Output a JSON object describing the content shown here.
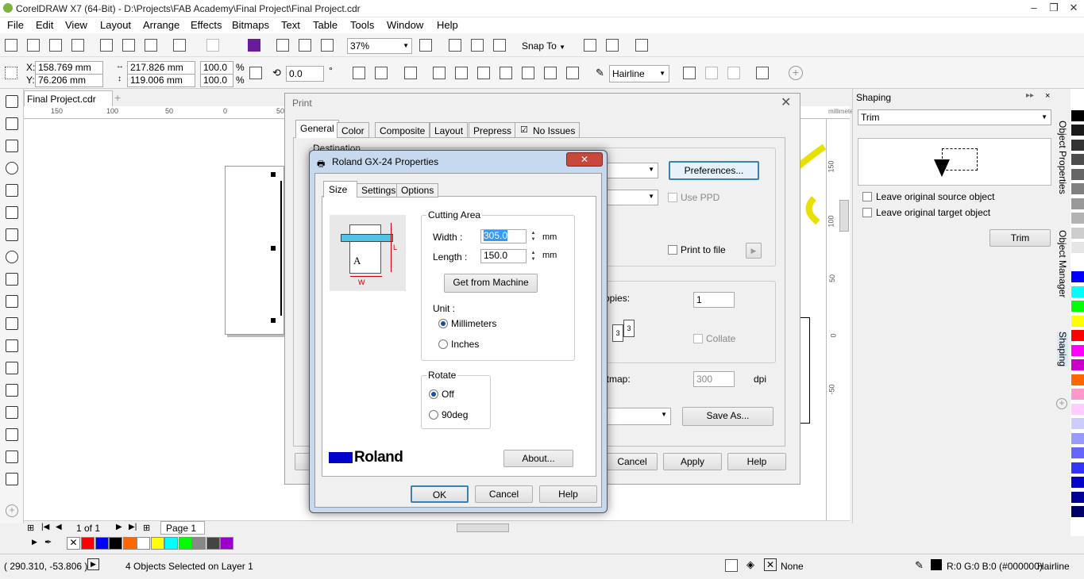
{
  "window": {
    "title": "CorelDRAW X7 (64-Bit) - D:\\Projects\\FAB Academy\\Final Project\\Final Project.cdr",
    "min": "–",
    "max": "❐",
    "close": "✕"
  },
  "menu": [
    "File",
    "Edit",
    "View",
    "Layout",
    "Arrange",
    "Effects",
    "Bitmaps",
    "Text",
    "Table",
    "Tools",
    "Window",
    "Help"
  ],
  "toolbar": {
    "zoom": "37%",
    "snap": "Snap To",
    "snap_arrow": "▼",
    "zoom_arrow": "▼"
  },
  "propbar": {
    "x_label": "X:",
    "x": "158.769 mm",
    "y_label": "Y:",
    "y": "76.206 mm",
    "w": "217.826 mm",
    "h": "119.006 mm",
    "sx": "100.0",
    "sy": "100.0",
    "pct1": "%",
    "pct2": "%",
    "rot": "0.0",
    "deg": "°",
    "outline": "Hairline",
    "outline_arrow": "▼"
  },
  "doc_tab": {
    "label": "Final Project.cdr",
    "plus": "+"
  },
  "ruler": {
    "ticks": [
      "150",
      "100",
      "50",
      "0",
      "50"
    ],
    "unit_v": "millimeters",
    "vticks": [
      "150",
      "100",
      "50",
      "0",
      "-50"
    ]
  },
  "shaping": {
    "title": "Shaping",
    "mode": "Trim",
    "arrow": "▼",
    "opt1": "Leave original source object",
    "opt2": "Leave original target object",
    "apply": "Trim",
    "collapse": "▸▸",
    "close": "×"
  },
  "sidetabs": [
    "Object Properties",
    "Object Manager",
    "Shaping"
  ],
  "page_nav": {
    "count": "1 of 1",
    "page": "Page 1"
  },
  "status": {
    "coords": "( 290.310, -53.806 )",
    "arrow": "▶",
    "selection": "4 Objects Selected on Layer 1",
    "fill": "None",
    "color": "R:0 G:0 B:0 (#000000)",
    "outline": "Hairline"
  },
  "print": {
    "title": "Print",
    "close": "✕",
    "tabs": [
      "General",
      "Color",
      "Composite",
      "Layout",
      "Prepress",
      "No Issues"
    ],
    "destination": "Destination",
    "preferences": "Preferences...",
    "use_ppd": "Use PPD",
    "print_to_file": "Print to file",
    "copies_label": "opies:",
    "copies": "1",
    "collate": "Collate",
    "bitmap_label": "itmap:",
    "bitmap_dpi": "300",
    "dpi": "dpi",
    "save_as": "Save As...",
    "cancel": "Cancel",
    "apply": "Apply",
    "help": "Help"
  },
  "roland": {
    "title": "Roland GX-24 Properties",
    "close": "✕",
    "tabs": [
      "Size",
      "Settings",
      "Options"
    ],
    "cutting_area": "Cutting Area",
    "width_label": "Width :",
    "width": "305.0",
    "length_label": "Length :",
    "length": "150.0",
    "mm1": "mm",
    "mm2": "mm",
    "get_from_machine": "Get from Machine",
    "unit": "Unit :",
    "millimeters": "Millimeters",
    "inches": "Inches",
    "rotate": "Rotate",
    "off": "Off",
    "deg90": "90deg",
    "brand": "Roland",
    "about": "About...",
    "ok": "OK",
    "cancel": "Cancel",
    "help": "Help",
    "diagram_a": "A",
    "diagram_l": "L",
    "diagram_w": "W"
  },
  "palette": {
    "colors": [
      "#ff0000",
      "#0000ff",
      "#000000",
      "#ff6600",
      "#ffffff",
      "#ffff00",
      "#00ffff",
      "#00ff00",
      "#888888",
      "#444444",
      "#9900cc"
    ]
  },
  "vpalette": {
    "colors": [
      "#ffffff",
      "#000000",
      "#1a1a1a",
      "#333333",
      "#4d4d4d",
      "#666666",
      "#808080",
      "#999999",
      "#b3b3b3",
      "#cccccc",
      "#e6e6e6",
      "#ffffff",
      "#0000ff",
      "#00ffff",
      "#00ff00",
      "#ffff00",
      "#ff0000",
      "#ff00ff",
      "#cc00cc",
      "#ff6600",
      "#ff99cc",
      "#ffccff",
      "#ccccff",
      "#9999ff",
      "#6666ff",
      "#3333ff",
      "#0000cc",
      "#000099",
      "#000066",
      "#ffffff"
    ]
  }
}
